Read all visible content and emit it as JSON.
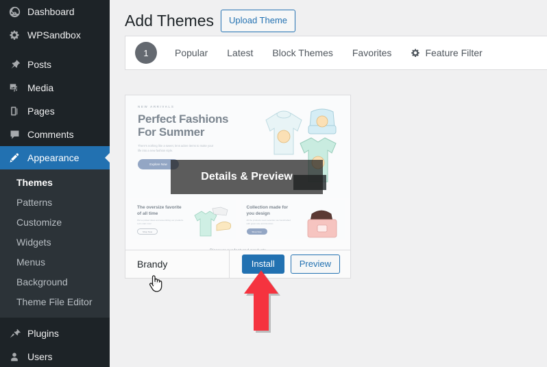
{
  "sidebar": {
    "items": [
      {
        "label": "Dashboard",
        "icon": "dashboard-icon",
        "active": false
      },
      {
        "label": "WPSandbox",
        "icon": "gear-icon",
        "active": false
      },
      {
        "label": "Posts",
        "icon": "pin-icon",
        "active": false
      },
      {
        "label": "Media",
        "icon": "media-icon",
        "active": false
      },
      {
        "label": "Pages",
        "icon": "pages-icon",
        "active": false
      },
      {
        "label": "Comments",
        "icon": "comments-icon",
        "active": false
      },
      {
        "label": "Appearance",
        "icon": "paintbrush-icon",
        "active": true
      },
      {
        "label": "Plugins",
        "icon": "plugins-icon",
        "active": false
      },
      {
        "label": "Users",
        "icon": "users-icon",
        "active": false
      }
    ],
    "submenu": [
      {
        "label": "Themes",
        "current": true
      },
      {
        "label": "Patterns",
        "current": false
      },
      {
        "label": "Customize",
        "current": false
      },
      {
        "label": "Widgets",
        "current": false
      },
      {
        "label": "Menus",
        "current": false
      },
      {
        "label": "Background",
        "current": false
      },
      {
        "label": "Theme File Editor",
        "current": false
      }
    ],
    "colors": {
      "background": "#1d2327",
      "submenu_background": "#2c3338",
      "active": "#2271b1"
    }
  },
  "header": {
    "title": "Add Themes",
    "upload_button": "Upload Theme"
  },
  "filter_bar": {
    "count_badge": "1",
    "links": [
      {
        "label": "Popular",
        "icon": ""
      },
      {
        "label": "Latest",
        "icon": ""
      },
      {
        "label": "Block Themes",
        "icon": ""
      },
      {
        "label": "Favorites",
        "icon": ""
      },
      {
        "label": "Feature Filter",
        "icon": "gear-icon"
      }
    ]
  },
  "theme_card": {
    "name": "Brandy",
    "overlay_label": "Details & Preview",
    "install_label": "Install",
    "preview_label": "Preview",
    "screenshot": {
      "eyebrow": "NEW ARRIVALS",
      "heading_line1": "Perfect Fashions",
      "heading_line2": "For Summer",
      "paragraph": "There's nothing like a sweet, lens adore items to make your life into a new fashion style.",
      "cta": "Explore Now",
      "promos": [
        {
          "heading": "The oversize favorite of all time",
          "paragraph": "We've picked ideas and assembling our products. Let's start now!",
          "button": "Shop Now",
          "style": "outline"
        },
        {
          "heading": "Collection made for you design",
          "paragraph": "All the products news selection we handcrafted with great care and devotion.",
          "button": "Shop Now",
          "style": "solid"
        }
      ],
      "footer_text": "Discover our featured products"
    }
  },
  "annotations": {
    "cursor": "pointer-hand-cursor",
    "arrow": "red-arrow-up",
    "arrow_color": "#f5333f"
  },
  "colors": {
    "accent": "#2271b1",
    "page_background": "#f0f0f1",
    "panel": "#ffffff",
    "border": "#dcdcde",
    "text": "#1d2327",
    "muted_text": "#50575e"
  }
}
